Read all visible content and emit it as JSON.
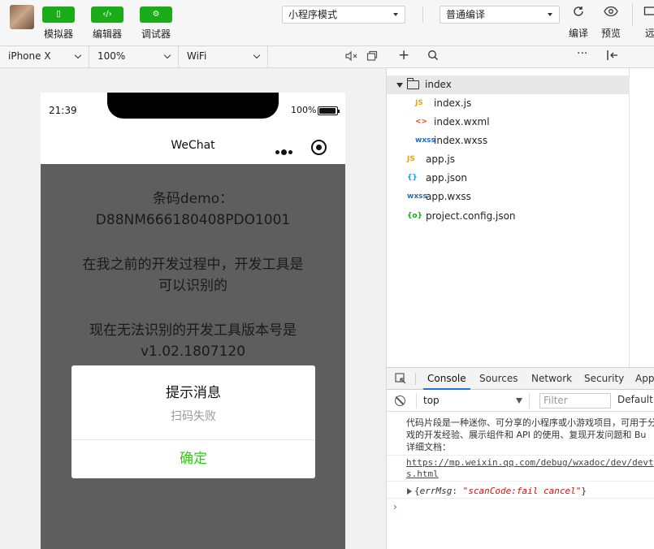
{
  "toolbar": {
    "simulator_label": "模拟器",
    "editor_label": "编辑器",
    "debugger_label": "调试器",
    "simulator_glyph": "▯",
    "editor_glyph": "‹/›",
    "debugger_glyph": "⚙",
    "mode_select": "小程序模式",
    "compile_select": "普通编译",
    "compile_label": "编译",
    "preview_label": "预览",
    "remote_label": "远"
  },
  "device_bar": {
    "device": "iPhone X",
    "zoom": "100%",
    "network": "WiFi"
  },
  "phone": {
    "time": "21:39",
    "battery": "100%",
    "nav_title": "WeChat",
    "content": {
      "line1": "条码demo：",
      "line2": "D88NM666180408PDO1001",
      "line3": "在我之前的开发过程中，开发工具是",
      "line4": "可以识别的",
      "line5": "现在无法识别的开发工具版本号是",
      "line6": "v1.02.1807120"
    },
    "modal": {
      "title": "提示消息",
      "content": "扫码失败",
      "confirm": "确定"
    }
  },
  "file_tree": {
    "folder": "index",
    "files": [
      {
        "icon": "JS",
        "name": "index.js",
        "color": "#e8a317"
      },
      {
        "icon": "<>",
        "name": "index.wxml",
        "color": "#e34c26"
      },
      {
        "icon": "wxss",
        "name": "index.wxss",
        "color": "#2a6db5"
      },
      {
        "icon": "JS",
        "name": "app.js",
        "color": "#e8a317"
      },
      {
        "icon": "{}",
        "name": "app.json",
        "color": "#1e9be0"
      },
      {
        "icon": "wxss",
        "name": "app.wxss",
        "color": "#2a6db5"
      },
      {
        "icon": "{o}",
        "name": "project.config.json",
        "color": "#1aad19"
      }
    ]
  },
  "devtools": {
    "tabs": [
      "Console",
      "Sources",
      "Network",
      "Security",
      "App"
    ],
    "active_tab": "Console",
    "context": "top",
    "filter_placeholder": "Filter",
    "levels": "Default l",
    "log_line1": "代码片段是一种迷你、可分享的小程序或小游戏项目，可用于分",
    "log_line2": "戏的开发经验、展示组件和 API 的使用、复现开发问题和 Bu",
    "log_line3": "详细文档：",
    "link_line1": "https://mp.weixin.qq.com/debug/wxadoc/dev/devt",
    "link_line2": "s.html",
    "err_open": "{",
    "err_key": "errMsg",
    "err_colon": ": ",
    "err_val": "\"scanCode:fail cancel\"",
    "err_close": "}",
    "prompt": "›"
  },
  "colors": {
    "accent_green": "#1aad19",
    "modal_confirm": "#3cc51f",
    "devtools_active": "#1a73e8"
  }
}
